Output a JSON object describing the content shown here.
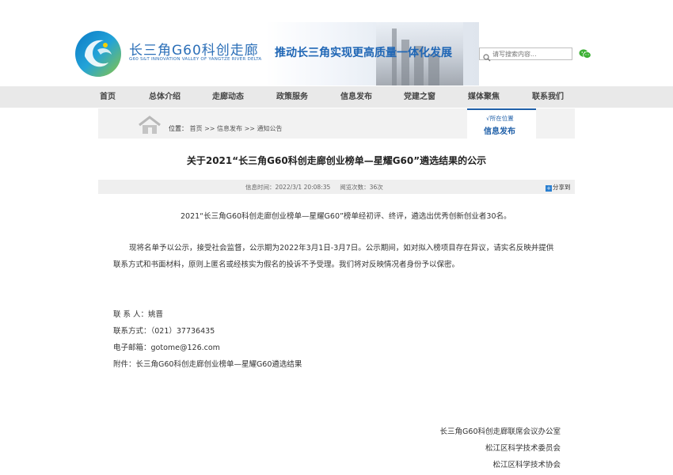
{
  "header": {
    "logo_cn": "长三角G60科创走廊",
    "logo_en": "G60 S&T INNOVATION VALLEY OF YANGTZE RIVER DELTA",
    "banner_text": "推动长三角实现更高质量一体化发展",
    "search_placeholder": "请写搜索内容...",
    "colors": {
      "brand": "#2b6fb8",
      "accent": "#1f5fa8"
    }
  },
  "nav": {
    "items": [
      "首页",
      "总体介绍",
      "走廊动态",
      "政策服务",
      "信息发布",
      "党建之窗",
      "媒体聚焦",
      "联系我们"
    ]
  },
  "location": {
    "label": "位置：",
    "crumbs": [
      "首页",
      ">>",
      "信息发布",
      ">>",
      "通知公告"
    ],
    "box_small": "√所在位置",
    "box_big": "信息发布"
  },
  "article": {
    "title": "关于2021“长三角G60科创走廊创业榜单—星耀G60”遴选结果的公示",
    "meta_time": "信息时间：2022/3/1 20:08:35",
    "meta_views": "阅览次数：36次",
    "share": "分享到",
    "para1": "2021“长三角G60科创走廊创业榜单—星耀G60”榜单经初评、终评，遴选出优秀创新创业者30名。",
    "para2_line1": "现将名单予以公示，接受社会监督，公示期为2022年3月1日-3月7日。公示期间，如对拟入榜项目存在异议，请实名反映并提供",
    "para2_line2": "联系方式和书面材料，原则上匿名或经核实为假名的投诉不予受理。我们将对反映情况者身份予以保密。",
    "contact_person": "联 系 人：姚晋",
    "contact_phone": "联系方式：（021）37736435",
    "contact_email": "电子邮箱：gotome@126.com",
    "attachment": "附件：长三角G60科创走廊创业榜单—星耀G60遴选结果",
    "sign1": "长三角G60科创走廊联席会议办公室",
    "sign2": "松江区科学技术委员会",
    "sign3": "松江区科学技术协会"
  }
}
